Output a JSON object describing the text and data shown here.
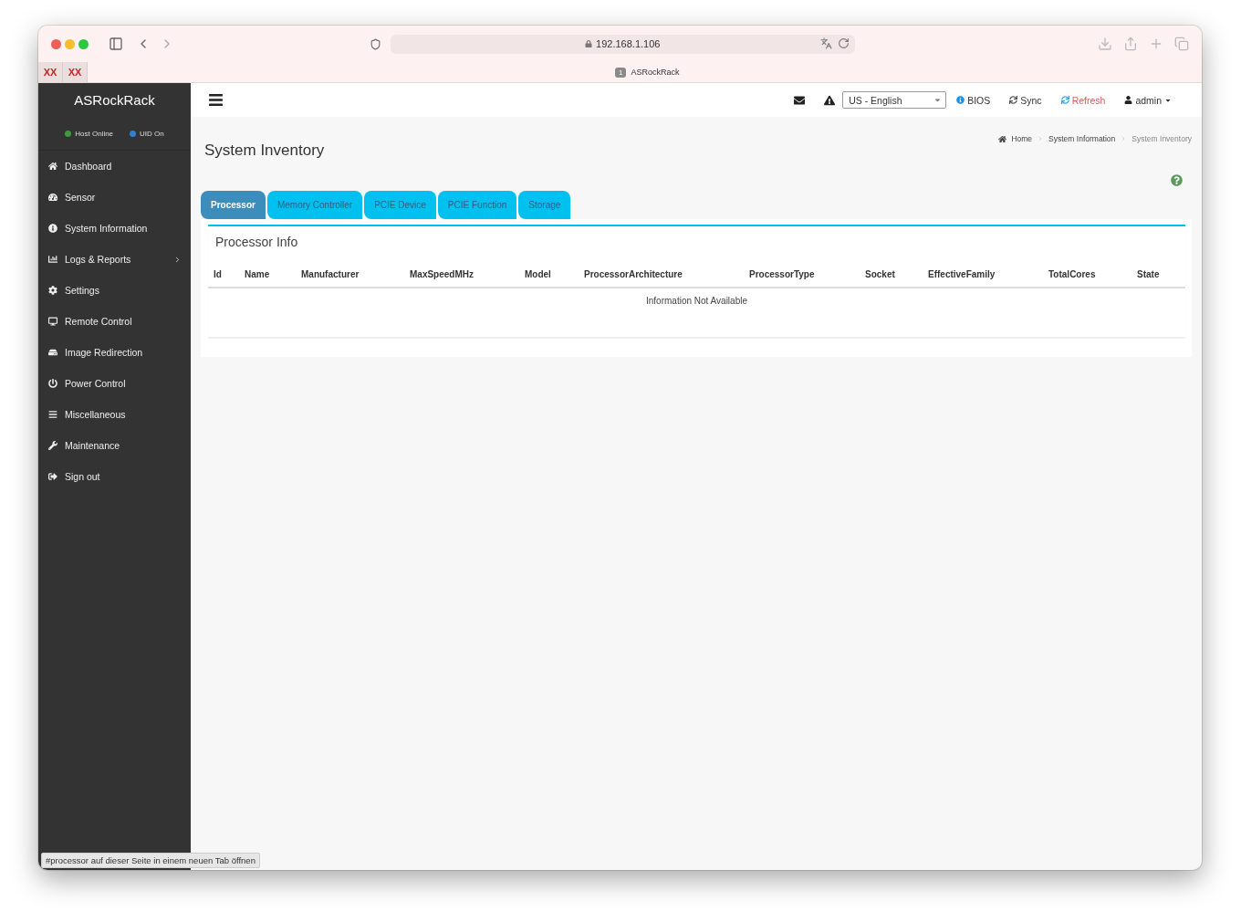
{
  "browser": {
    "address": "192.168.1.106",
    "bookmarks": [
      "XX",
      "XX"
    ],
    "tab": {
      "count": "1",
      "title": "ASRockRack"
    }
  },
  "brand": "ASRockRack",
  "status": [
    {
      "label": "Host Online",
      "color": "#3c9a3c"
    },
    {
      "label": "UID On",
      "color": "#2f80d0"
    }
  ],
  "sidebar": {
    "items": [
      {
        "label": "Dashboard",
        "expandable": false
      },
      {
        "label": "Sensor",
        "expandable": false
      },
      {
        "label": "System Information",
        "expandable": false
      },
      {
        "label": "Logs & Reports",
        "expandable": true
      },
      {
        "label": "Settings",
        "expandable": false
      },
      {
        "label": "Remote Control",
        "expandable": false
      },
      {
        "label": "Image Redirection",
        "expandable": false
      },
      {
        "label": "Power Control",
        "expandable": false
      },
      {
        "label": "Miscellaneous",
        "expandable": false
      },
      {
        "label": "Maintenance",
        "expandable": false
      },
      {
        "label": "Sign out",
        "expandable": false
      }
    ]
  },
  "topbar": {
    "language": "US - English",
    "links": [
      "BIOS",
      "Sync",
      "Refresh",
      "admin"
    ]
  },
  "page": {
    "title": "System Inventory",
    "breadcrumb": [
      "Home",
      "System Information",
      "System Inventory"
    ]
  },
  "tabs": [
    {
      "label": "Processor",
      "selected": true
    },
    {
      "label": "Memory Controller",
      "selected": false
    },
    {
      "label": "PCIE Device",
      "selected": false
    },
    {
      "label": "PCIE Function",
      "selected": false
    },
    {
      "label": "Storage",
      "selected": false
    }
  ],
  "panel": {
    "title": "Processor Info",
    "columns": [
      "Id",
      "Name",
      "Manufacturer",
      "MaxSpeedMHz",
      "Model",
      "ProcessorArchitecture",
      "ProcessorType",
      "Socket",
      "EffectiveFamily",
      "TotalCores",
      "State"
    ],
    "empty_message": "Information Not Available"
  },
  "status_bar": "#processor auf dieser Seite in einem neuen Tab öffnen"
}
